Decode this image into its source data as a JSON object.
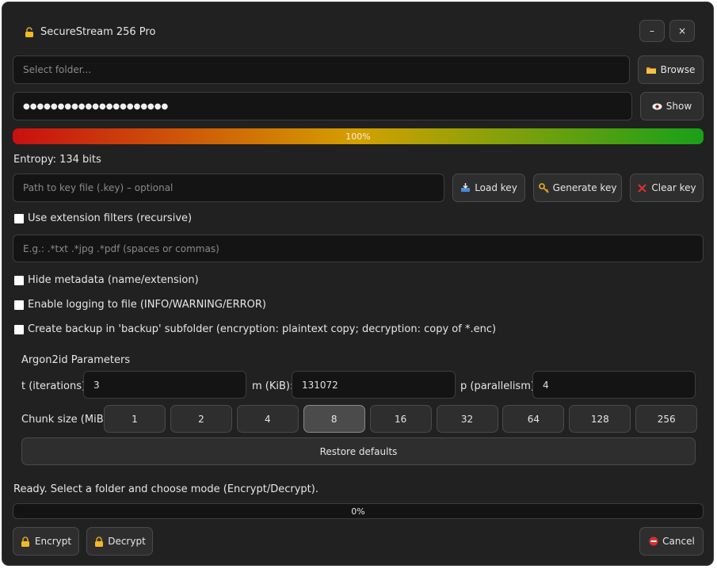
{
  "window": {
    "title": "SecureStream 256 Pro",
    "minimize_label": "–",
    "close_label": "×"
  },
  "folder": {
    "placeholder": "Select folder...",
    "value": "",
    "browse_label": "Browse"
  },
  "password": {
    "value": "●●●●●●●●●●●●●●●●●●●●●",
    "show_label": "Show"
  },
  "strength": {
    "percent_label": "100%",
    "fraction": 1.0,
    "colors": [
      "#c81010",
      "#d4a000",
      "#18a018"
    ]
  },
  "entropy": {
    "text": "Entropy: 134 bits"
  },
  "keyfile": {
    "placeholder": "Path to key file (.key) – optional",
    "load_label": "Load key",
    "generate_label": "Generate key",
    "clear_label": "Clear key"
  },
  "filters": {
    "checkbox_label": "Use extension filters (recursive)",
    "placeholder": "E.g.: .*txt .*jpg .*pdf (spaces or commas)"
  },
  "options": {
    "hide_metadata": "Hide metadata (name/extension)",
    "logging": "Enable logging to file (INFO/WARNING/ERROR)",
    "backup": "Create backup in 'backup' subfolder (encryption: plaintext copy; decryption: copy of *.enc)"
  },
  "argon": {
    "title": "Argon2id Parameters",
    "t_label": "t (iterations):",
    "t_value": "3",
    "m_label": "m (KiB):",
    "m_value": "131072",
    "p_label": "p (parallelism):",
    "p_value": "4",
    "chunk_label": "Chunk size (MiB):",
    "chunks": [
      "1",
      "2",
      "4",
      "8",
      "16",
      "32",
      "64",
      "128",
      "256"
    ],
    "selected_chunk": "8",
    "restore_label": "Restore defaults"
  },
  "status": {
    "text": "Ready. Select a folder and choose mode (Encrypt/Decrypt).",
    "progress_label": "0%",
    "progress_fraction": 0.0
  },
  "actions": {
    "encrypt_label": "Encrypt",
    "decrypt_label": "Decrypt",
    "cancel_label": "Cancel"
  },
  "icons": {
    "app": "padlock-icon",
    "browse": "folder-icon",
    "show": "eye-icon",
    "load": "key-load-icon",
    "generate": "key-icon",
    "clear": "red-x-icon",
    "encrypt": "lock-icon",
    "decrypt": "lock-icon",
    "cancel": "no-entry-icon"
  }
}
